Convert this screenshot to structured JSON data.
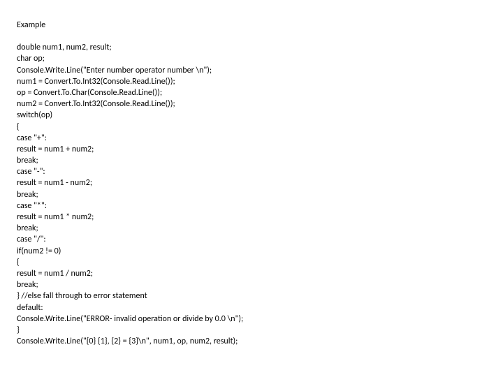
{
  "title": "Example",
  "code_lines": [
    "double num1, num2, result;",
    "char op;",
    "Console.Write.Line(\"Enter number operator number \\n\");",
    "num1 = Convert.To.Int32(Console.Read.Line());",
    "op = Convert.To.Char(Console.Read.Line());",
    "num2 = Convert.To.Int32(Console.Read.Line());",
    "switch(op)",
    "{",
    "case \"+\":",
    "result = num1 + num2;",
    "break;",
    "case \"-\":",
    "result = num1 - num2;",
    "break;",
    "case \"*\":",
    "result = num1 * num2;",
    "break;",
    "case \"/\":",
    "if(num2 != 0)",
    "{",
    "result = num1 / num2;",
    "break;",
    "} //else fall through to error statement",
    "default:",
    "Console.Write.Line(\"ERROR- invalid operation or divide by 0.0 \\n\");",
    "}",
    "Console.Write.Line(\"{0} {1}, {2} = {3}\\n\", num1, op, num2, result);"
  ]
}
